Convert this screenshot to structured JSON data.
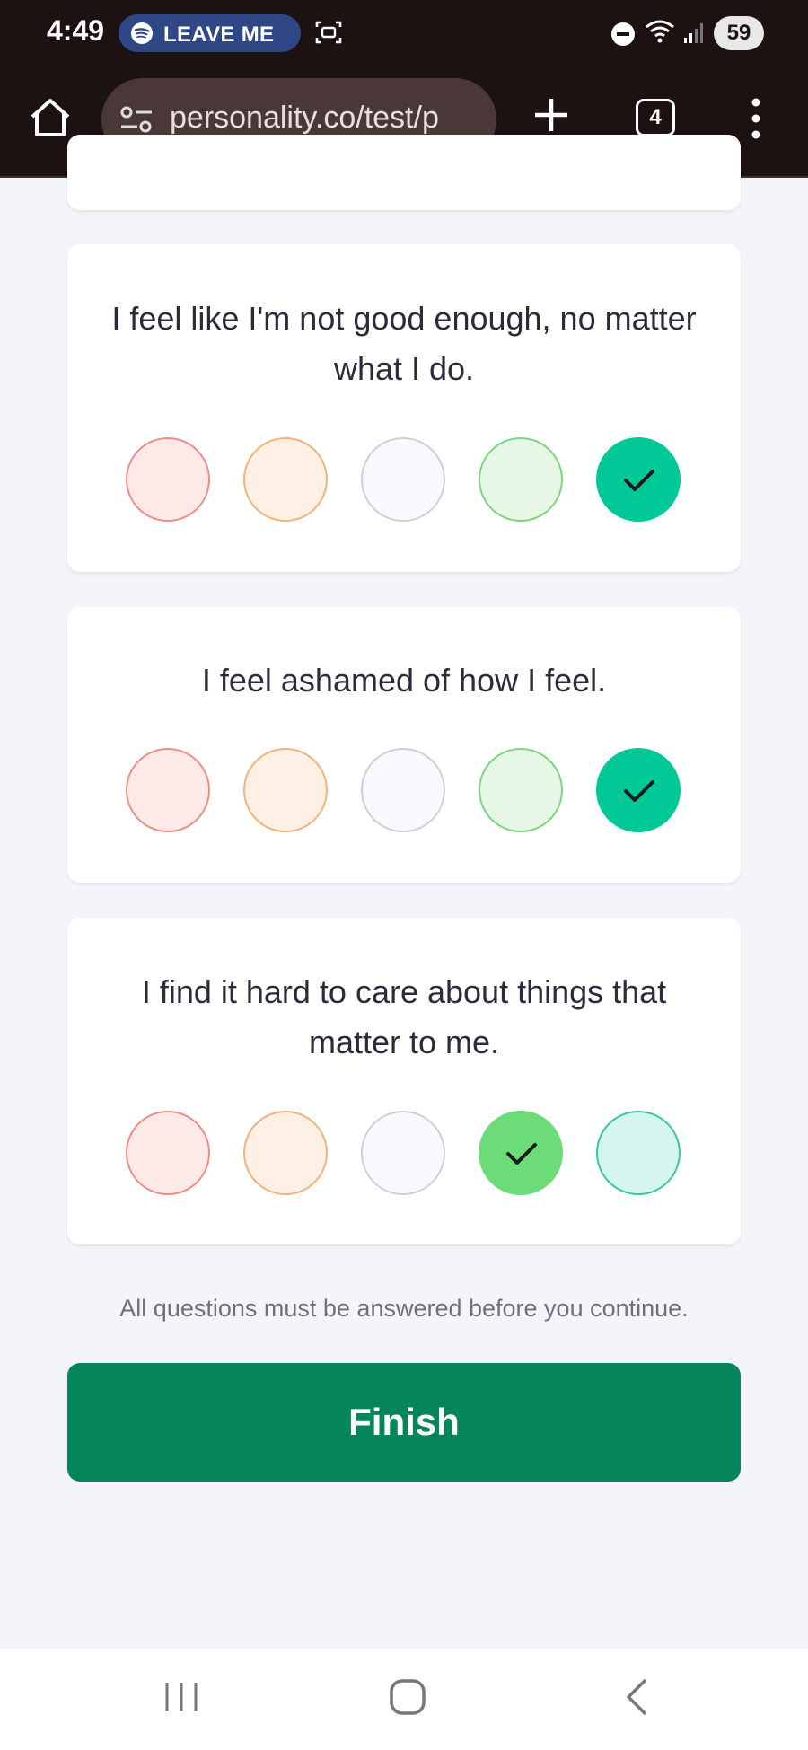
{
  "status_bar": {
    "time": "4:49",
    "spotify_pill": "LEAVE ME",
    "battery": "59"
  },
  "browser": {
    "url": "personality.co/test/p",
    "tab_count": "4"
  },
  "questions": [
    {
      "text": "I feel like I'm not good enough, no matter what I do.",
      "selected": 5
    },
    {
      "text": "I feel ashamed of how I feel.",
      "selected": 5
    },
    {
      "text": "I find it hard to care about things that matter to me.",
      "selected": 4
    }
  ],
  "notice": "All questions must be answered before you continue.",
  "finish_label": "Finish",
  "colors": {
    "finish_button": "#05865a",
    "selected_agree": "#00c896",
    "selected_slightly_agree": "#6cdc79",
    "browser_chrome": "#1c1212"
  }
}
